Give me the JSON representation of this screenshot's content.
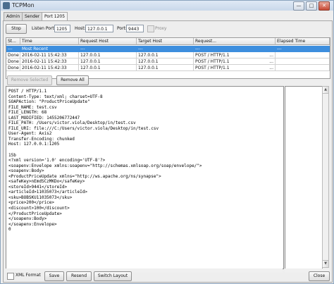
{
  "window": {
    "title": "TCPMon",
    "minimize": "—",
    "maximize": "□",
    "close": "✕"
  },
  "tabs": [
    {
      "label": "Admin"
    },
    {
      "label": "Sender"
    },
    {
      "label": "Port 1205"
    }
  ],
  "toolbar": {
    "stop_label": "Stop",
    "listen_port_label": "Listen Port:",
    "listen_port_value": "1205",
    "host_label": "Host:",
    "host_value": "127.0.0.1",
    "port_label": "Port:",
    "port_value": "9443",
    "proxy_label": "Proxy",
    "proxy_checked": false
  },
  "table": {
    "columns": [
      "St...",
      "Time",
      "Request Host",
      "Target Host",
      "Request...",
      "Elapsed Time"
    ],
    "selected_row": [
      "---",
      "Most Recent",
      "---",
      "---",
      "---",
      "---"
    ],
    "rows": [
      [
        "Done",
        "2016-02-11 15:42:33",
        "127.0.0.1",
        "127.0.0.1",
        "POST / HTTP/1.1",
        "..."
      ],
      [
        "Done",
        "2016-02-11 15:42:33",
        "127.0.0.1",
        "127.0.0.1",
        "POST / HTTP/1.1",
        "..."
      ],
      [
        "Done",
        "2016-02-11 15:42:33",
        "127.0.0.1",
        "127.0.0.1",
        "POST / HTTP/1.1",
        "..."
      ]
    ]
  },
  "actions": {
    "remove_selected_label": "Remove Selected",
    "remove_all_label": "Remove All"
  },
  "request_text": "POST / HTTP/1.1\nContent-Type: text/xml; charset=UTF-8\nSOAPAction: \"ProductPriceUpdate\"\nFILE_NAME: test.csv\nFILE_LENGTH: 68\nLAST_MODIFIED: 1455206772447\nFILE_PATH: /Users/victor.viola/Desktop/in/test.csv\nFILE_URI: file:///C:/Users/victor.viola/Desktop/in/test.csv\nUser-Agent: Axis2\nTransfer-Encoding: chunked\nHost: 127.0.0.1:1205\n\n15b\n<?xml version='1.0' encoding='UTF-8'?>\n<soapenv:Envelope xmlns:soapenv=\"http://schemas.xmlsoap.org/soap/envelope/\">\n<soapenv:Body>\n<ProductPriceUpdate xmlns=\"http://ws.apache.org/ns/synapse\">\n<safeKey>nEmdSCzMKDo</safeKey>\n<storeId>9441</storeId>\n<articleId>11035073</articleId>\n<sku>BOBSKU11035073</sku>\n<price>200</price>\n<discount>100</discount>\n</ProductPriceUpdate>\n</soapenv:Body>\n</soapenv:Envelope>\n0",
  "bottom_bar": {
    "xml_format_label": "XML Format",
    "xml_format_checked": false,
    "save_label": "Save",
    "resend_label": "Resend",
    "switch_layout_label": "Switch Layout",
    "close_label": "Close"
  }
}
